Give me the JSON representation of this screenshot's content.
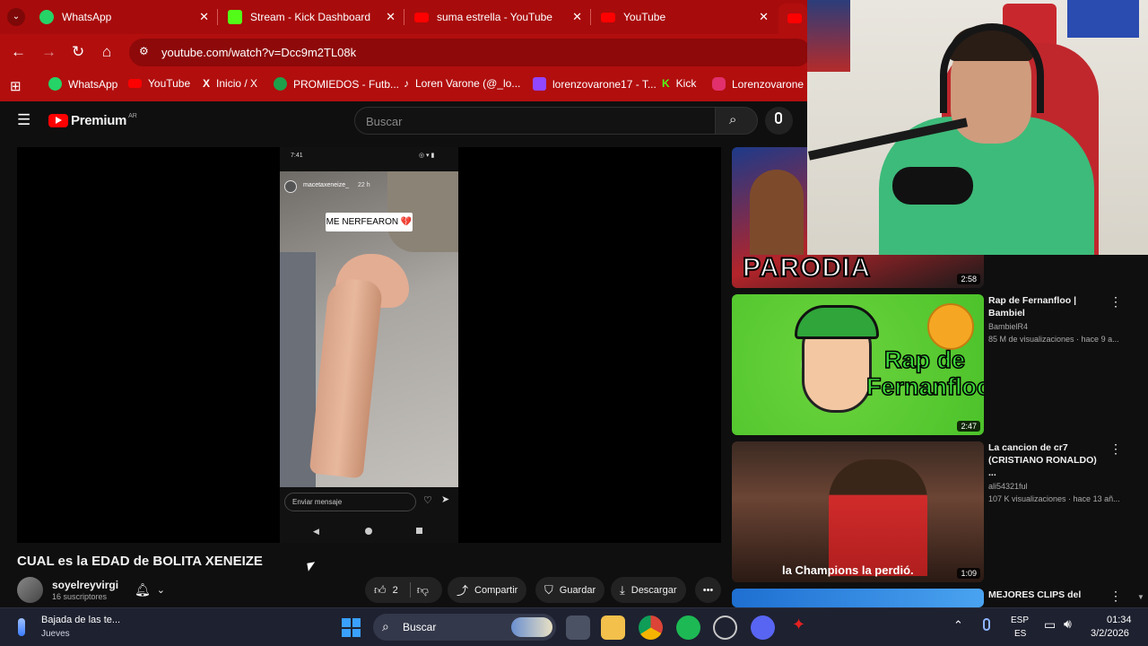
{
  "browser": {
    "tabs": [
      {
        "label": "WhatsApp",
        "color": "#25d366"
      },
      {
        "label": "Stream - Kick Dashboard",
        "color": "#53fc18"
      },
      {
        "label": "suma estrella - YouTube",
        "color": "#ff0000"
      },
      {
        "label": "YouTube",
        "color": "#ff0000"
      }
    ],
    "url": "youtube.com/watch?v=Dcc9m2TL08k",
    "bookmarks": [
      {
        "label": "WhatsApp",
        "color": "#25d366"
      },
      {
        "label": "YouTube",
        "color": "#ff0000"
      },
      {
        "label": "Inicio / X",
        "color": "#000000"
      },
      {
        "label": "PROMIEDOS - Futb...",
        "color": "#1fa04a"
      },
      {
        "label": "Loren Varone (@_lo...",
        "color": "#000000"
      },
      {
        "label": "lorenzovarone17 - T...",
        "color": "#9146ff"
      },
      {
        "label": "Kick",
        "color": "#53fc18"
      },
      {
        "label": "Lorenzovarone (I",
        "color": "#e1306c"
      }
    ]
  },
  "youtube": {
    "logo": "Premium",
    "region": "AR",
    "search_placeholder": "Buscar",
    "video": {
      "phone_time": "7:41",
      "story_user": "macetaxeneize_",
      "story_age": "22 h",
      "sticker": "ME NERFEARON 💔",
      "message_placeholder": "Enviar mensaje",
      "title": "CUAL es la EDAD de BOLITA XENEIZE",
      "channel": "soyelreyvirgi",
      "subscribers": "16 suscriptores",
      "likes": "2",
      "share": "Compartir",
      "save": "Guardar",
      "download": "Descargar"
    },
    "recommendations": [
      {
        "thumb_text": "PARODIA",
        "duration": "2:58",
        "title": "",
        "channel": "",
        "views": ""
      },
      {
        "thumb_text": "Rap de Fernanfloo",
        "duration": "2:47",
        "title": "Rap de Fernanfloo | Bambiel",
        "channel": "BambielR4",
        "views": "85 M de visualizaciones · hace 9 a..."
      },
      {
        "thumb_text": "la Champions la perdió.",
        "duration": "1:09",
        "title": "La cancion de cr7 (CRISTIANO RONALDO) ...",
        "channel": "ali54321ful",
        "views": "107 K visualizaciones · hace 13 añ..."
      },
      {
        "thumb_text": "",
        "duration": "",
        "title": "MEJORES CLIPS del",
        "channel": "",
        "views": ""
      }
    ]
  },
  "taskbar": {
    "weather_title": "Bajada de las te...",
    "weather_sub": "Jueves",
    "search": "Buscar",
    "lang_top": "ESP",
    "lang_bottom": "ES",
    "time": "01:34",
    "date": "3/2/2026"
  }
}
